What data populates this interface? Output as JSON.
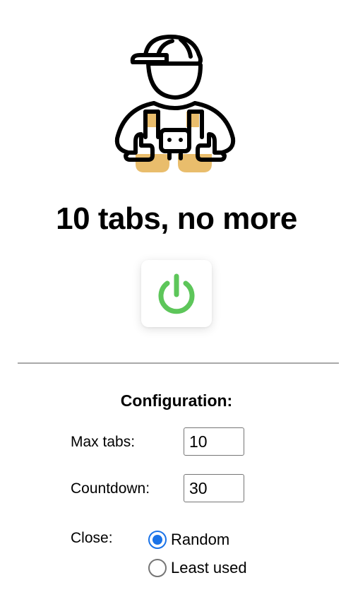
{
  "header": {
    "mascot_icon": "worker-with-cap-icon",
    "title": "10 tabs, no more"
  },
  "power_button": {
    "icon": "power-icon",
    "color": "#5dc65a"
  },
  "config": {
    "heading": "Configuration:",
    "max_tabs": {
      "label": "Max tabs:",
      "value": "10"
    },
    "countdown": {
      "label": "Countdown:",
      "value": "30"
    },
    "close": {
      "label": "Close:",
      "options": [
        {
          "label": "Random",
          "checked": true
        },
        {
          "label": "Least used",
          "checked": false
        }
      ]
    }
  },
  "colors": {
    "accent": "#1a73e8",
    "mascot_fill": "#e9bd6c",
    "divider": "#a9a9a9"
  }
}
